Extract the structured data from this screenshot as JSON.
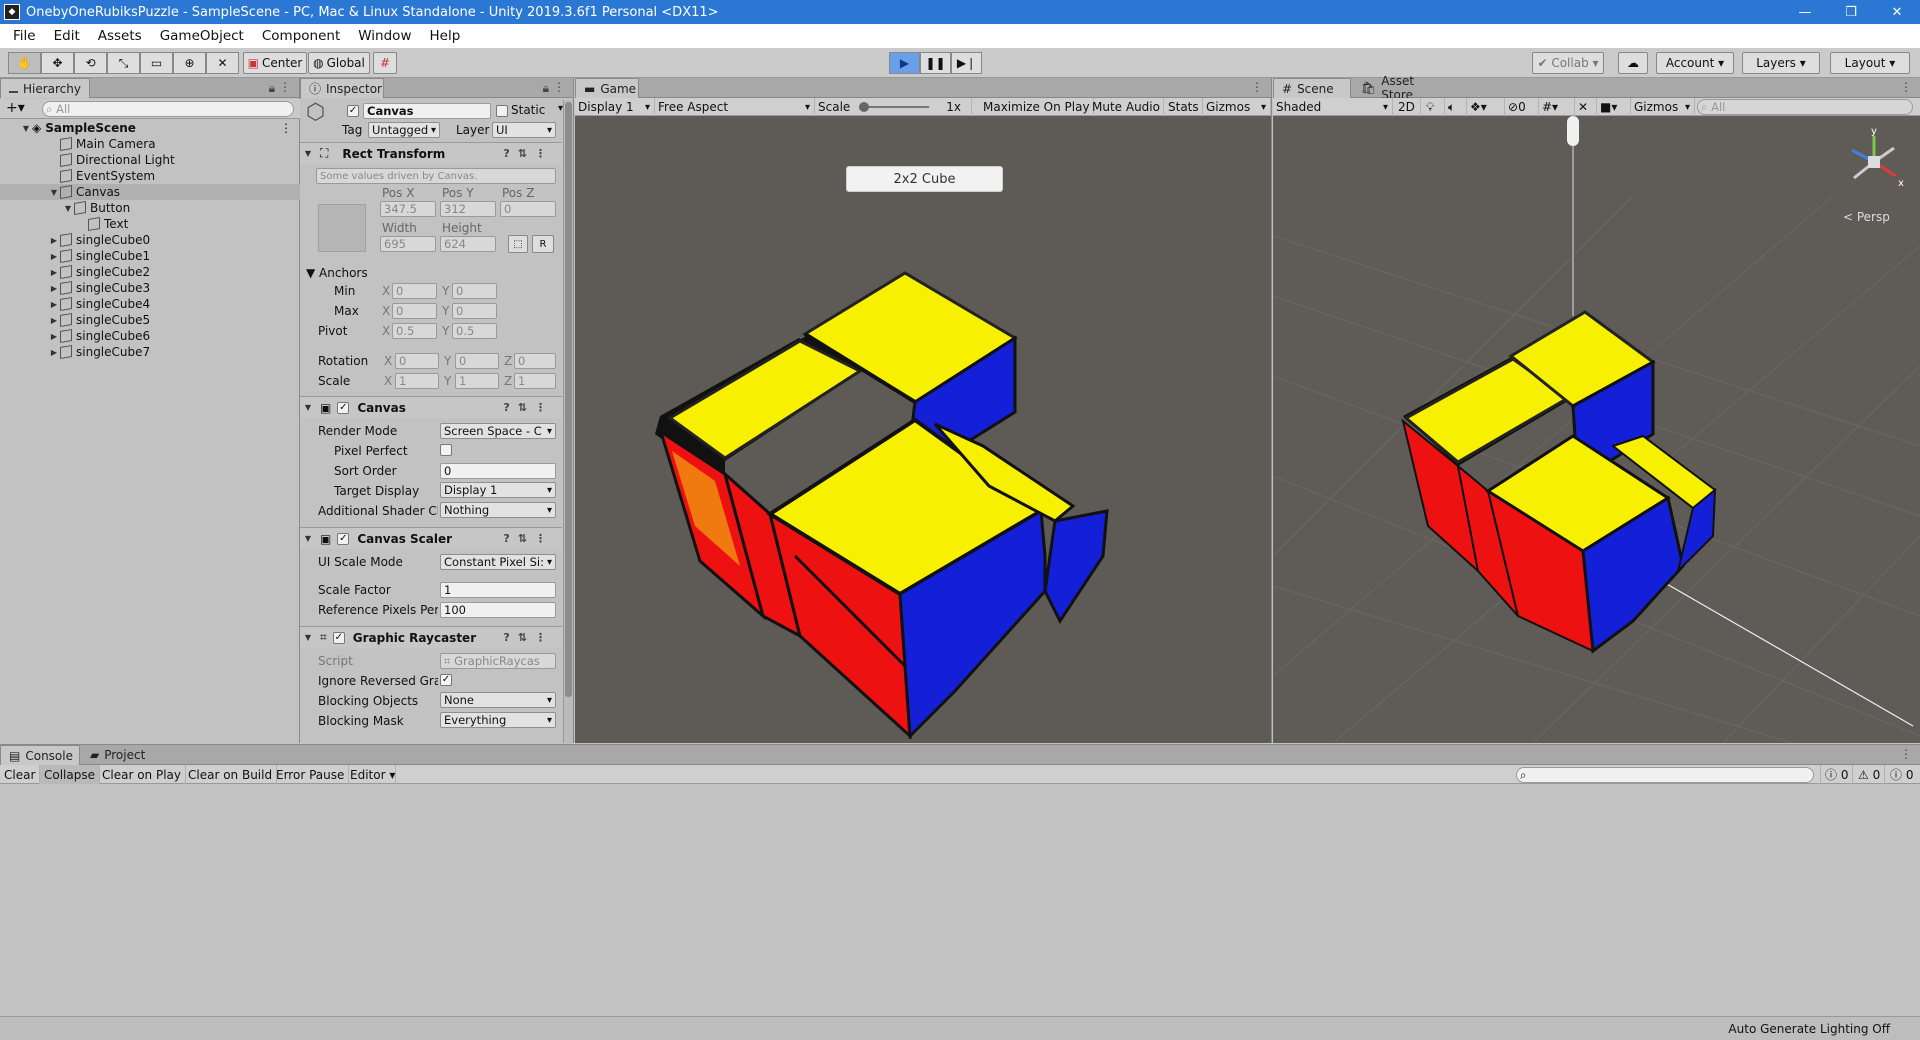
{
  "window": {
    "title": "OnebyOneRubiksPuzzle - SampleScene - PC, Mac & Linux Standalone - Unity 2019.3.6f1 Personal <DX11>"
  },
  "menu": [
    "File",
    "Edit",
    "Assets",
    "GameObject",
    "Component",
    "Window",
    "Help"
  ],
  "toolbar": {
    "pivot": "Center",
    "space": "Global",
    "collab": "Collab",
    "account": "Account",
    "layers": "Layers",
    "layout": "Layout"
  },
  "hierarchy": {
    "tab": "Hierarchy",
    "search_placeholder": "All",
    "scene": "SampleScene",
    "items": [
      {
        "label": "Main Camera"
      },
      {
        "label": "Directional Light"
      },
      {
        "label": "EventSystem"
      },
      {
        "label": "Canvas"
      },
      {
        "label": "Button"
      },
      {
        "label": "Text"
      },
      {
        "label": "singleCube0"
      },
      {
        "label": "singleCube1"
      },
      {
        "label": "singleCube2"
      },
      {
        "label": "singleCube3"
      },
      {
        "label": "singleCube4"
      },
      {
        "label": "singleCube5"
      },
      {
        "label": "singleCube6"
      },
      {
        "label": "singleCube7"
      }
    ]
  },
  "inspector": {
    "tab": "Inspector",
    "object_name": "Canvas",
    "static_label": "Static",
    "tag_label": "Tag",
    "tag_value": "Untagged",
    "layer_label": "Layer",
    "layer_value": "UI",
    "rect_transform": {
      "title": "Rect Transform",
      "note": "Some values driven by Canvas.",
      "posx_label": "Pos X",
      "posy_label": "Pos Y",
      "posz_label": "Pos Z",
      "posx": "347.5",
      "posy": "312",
      "posz": "0",
      "width_label": "Width",
      "height_label": "Height",
      "width": "695",
      "height": "624",
      "r_button": "R",
      "anchors": "Anchors",
      "min": "Min",
      "max": "Max",
      "pivot": "Pivot",
      "min_x": "0",
      "min_y": "0",
      "max_x": "0",
      "max_y": "0",
      "pivot_x": "0.5",
      "pivot_y": "0.5",
      "rotation": "Rotation",
      "rot_x": "0",
      "rot_y": "0",
      "rot_z": "0",
      "scale": "Scale",
      "scale_x": "1",
      "scale_y": "1",
      "scale_z": "1",
      "x": "X",
      "y": "Y",
      "z": "Z"
    },
    "canvas": {
      "title": "Canvas",
      "render_mode_label": "Render Mode",
      "render_mode": "Screen Space - C",
      "pixel_perfect_label": "Pixel Perfect",
      "sort_order_label": "Sort Order",
      "sort_order": "0",
      "target_display_label": "Target Display",
      "target_display": "Display 1",
      "shader_label": "Additional Shader Ch",
      "shader_value": "Nothing"
    },
    "scaler": {
      "title": "Canvas Scaler",
      "ui_scale_label": "UI Scale Mode",
      "ui_scale": "Constant Pixel Si:",
      "scale_factor_label": "Scale Factor",
      "scale_factor": "1",
      "ref_pixels_label": "Reference Pixels Per",
      "ref_pixels": "100"
    },
    "raycaster": {
      "title": "Graphic Raycaster",
      "script_label": "Script",
      "script": "GraphicRaycas",
      "ignore_label": "Ignore Reversed Grap",
      "blocking_objects_label": "Blocking Objects",
      "blocking_objects": "None",
      "blocking_mask_label": "Blocking Mask",
      "blocking_mask": "Everything"
    }
  },
  "game": {
    "tab": "Game",
    "display": "Display 1",
    "aspect": "Free Aspect",
    "scale_label": "Scale",
    "scale_value": "1x",
    "maximize": "Maximize On Play",
    "mute": "Mute Audio",
    "stats": "Stats",
    "gizmos": "Gizmos",
    "button_label": "2x2 Cube"
  },
  "scene": {
    "tab": "Scene",
    "tab2": "Asset Store",
    "shading": "Shaded",
    "mode2d": "2D",
    "hidden_count": "0",
    "gizmos": "Gizmos",
    "search_placeholder": "All",
    "persp": "< Persp",
    "axis_y": "y",
    "axis_x": "x"
  },
  "console": {
    "tab": "Console",
    "tab2": "Project",
    "clear": "Clear",
    "collapse": "Collapse",
    "clear_on_play": "Clear on Play",
    "clear_on_build": "Clear on Build",
    "error_pause": "Error Pause",
    "editor": "Editor",
    "log_count": "0",
    "warn_count": "0",
    "err_count": "0"
  },
  "status": {
    "text": "Auto Generate Lighting Off"
  },
  "colors": {
    "accent": "#2b78d4",
    "cube_yellow": "#f7f000",
    "cube_blue": "#1420d8",
    "cube_red": "#ee1111",
    "viewport_bg": "#5e5a55"
  }
}
